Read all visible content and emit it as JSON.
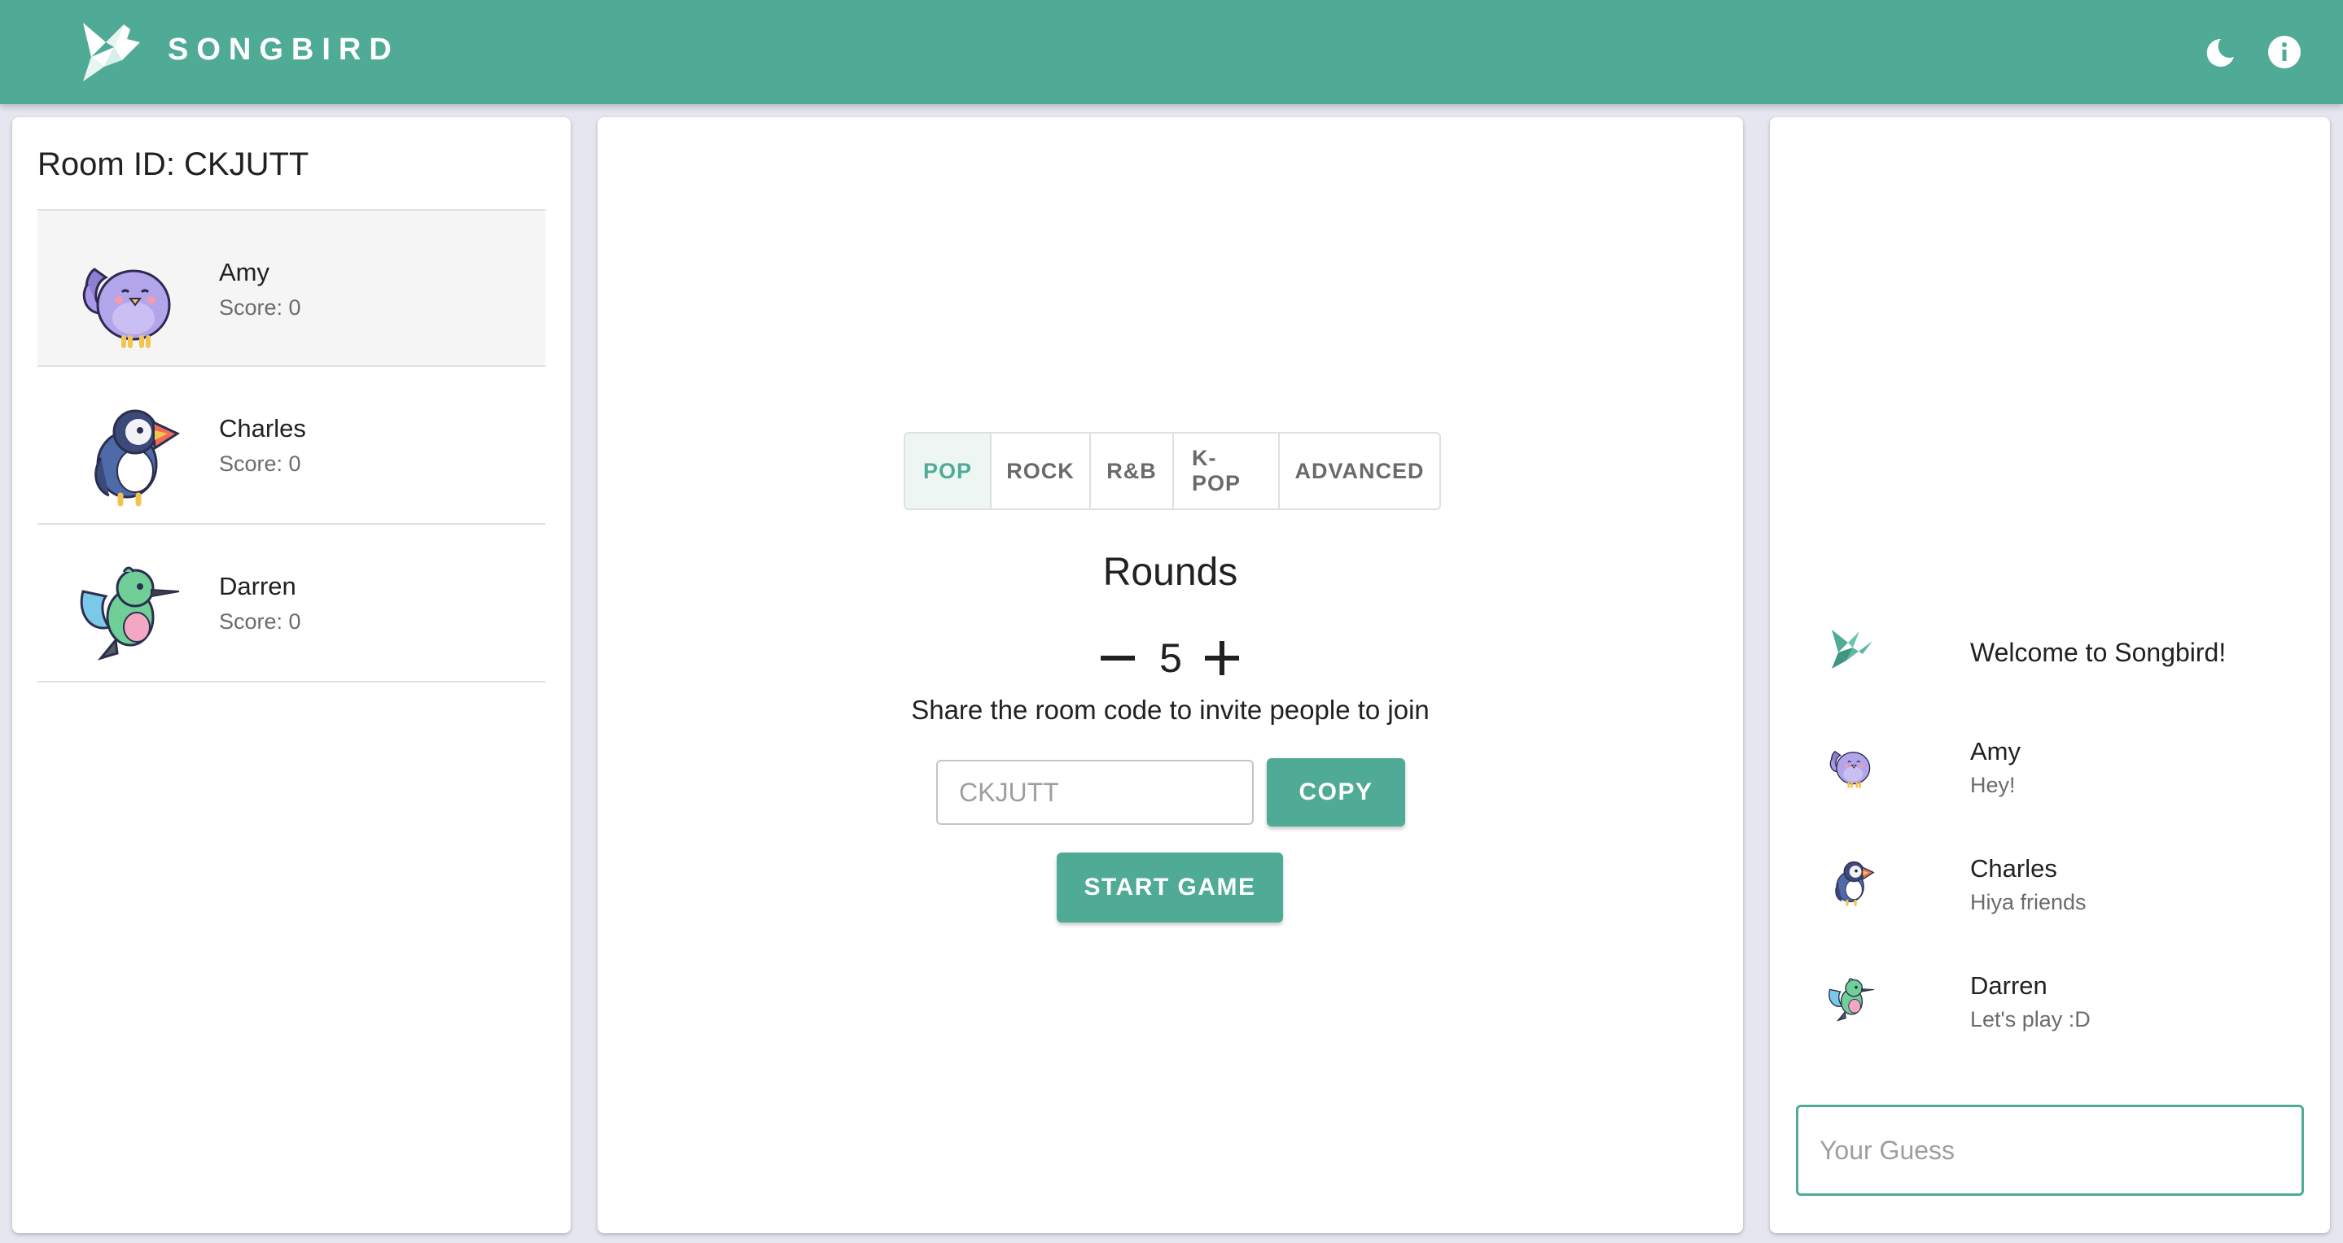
{
  "app": {
    "brand": "SONGBIRD",
    "accent_color": "#4fab96",
    "icons": {
      "logo": "origami-bird-icon",
      "theme_toggle": "moon-icon",
      "info": "info-icon"
    }
  },
  "lobby": {
    "room_id_label": "Room ID: CKJUTT",
    "players": [
      {
        "name": "Amy",
        "score": "Score: 0",
        "avatar": "purple-bird-avatar",
        "selected": true
      },
      {
        "name": "Charles",
        "score": "Score: 0",
        "avatar": "puffin-avatar"
      },
      {
        "name": "Darren",
        "score": "Score: 0",
        "avatar": "hummingbird-avatar"
      }
    ]
  },
  "setup": {
    "genres": [
      "POP",
      "ROCK",
      "R&B",
      "K-POP",
      "ADVANCED"
    ],
    "selected_genre": "POP",
    "rounds_title": "Rounds",
    "rounds_value": "5",
    "share_text": "Share the room code to invite people to join",
    "room_code_placeholder": "CKJUTT",
    "copy_label": "COPY",
    "start_label": "START GAME"
  },
  "chat": {
    "welcome": "Welcome to Songbird!",
    "messages": [
      {
        "name": "Amy",
        "text": "Hey!",
        "avatar": "purple-bird-avatar"
      },
      {
        "name": "Charles",
        "text": "Hiya friends",
        "avatar": "puffin-avatar"
      },
      {
        "name": "Darren",
        "text": "Let's play :D",
        "avatar": "hummingbird-avatar"
      }
    ],
    "guess_placeholder": "Your Guess"
  }
}
